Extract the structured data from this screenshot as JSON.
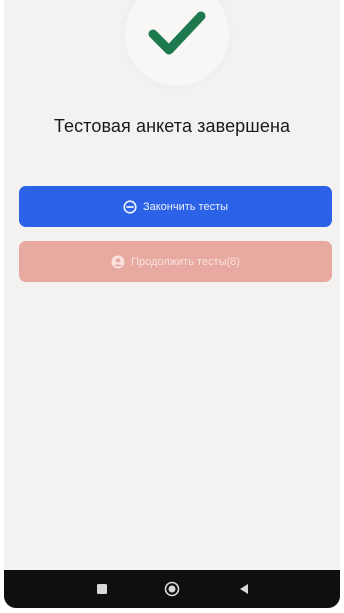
{
  "screen": {
    "title": "Тестовая анкета завершена",
    "success_icon": "checkmark-icon"
  },
  "buttons": {
    "finish": {
      "label": "Закончить тесты",
      "icon": "minus-circle-icon"
    },
    "continue": {
      "label": "Продолжить тесты(8)",
      "icon": "user-circle-icon"
    }
  },
  "navbar": {
    "items": [
      "recents-square-icon",
      "home-circle-icon",
      "back-triangle-icon"
    ]
  },
  "colors": {
    "check": "#1e7a4e",
    "finish_button": "#2c62e8",
    "continue_button": "#e8a9a0",
    "background": "#f3f2f1",
    "navbar": "#0f0f0f"
  }
}
